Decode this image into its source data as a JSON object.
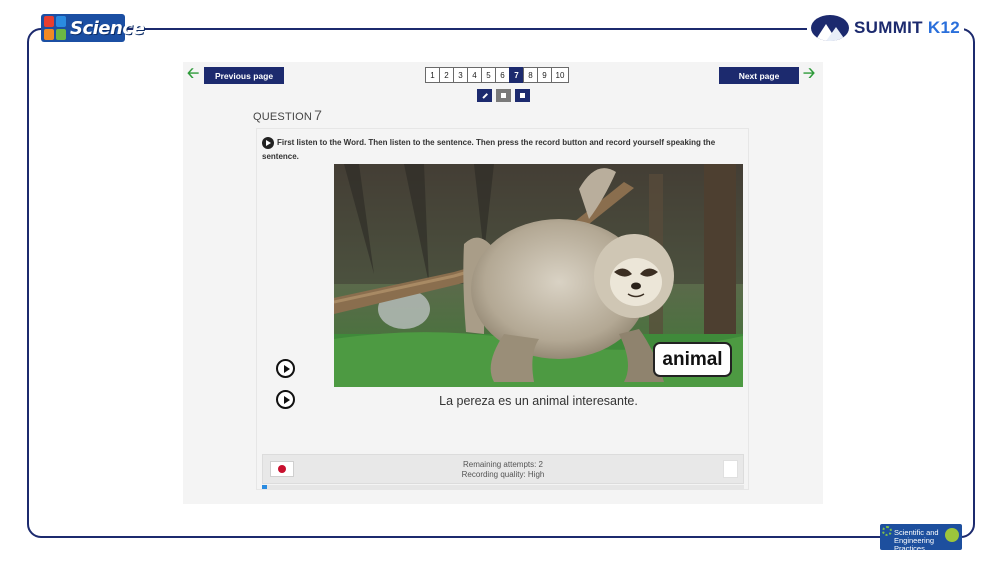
{
  "branding": {
    "science_logo_text": "Science",
    "summit_logo_text": "SUMMIT",
    "summit_logo_suffix": "K12",
    "badge_text": "Scientific and Engineering Practices"
  },
  "nav": {
    "previous_label": "Previous page",
    "next_label": "Next page",
    "pages": [
      "1",
      "2",
      "3",
      "4",
      "5",
      "6",
      "7",
      "8",
      "9",
      "10"
    ],
    "current_page": "7"
  },
  "tools": {
    "icons": [
      "pencil-icon",
      "stop-icon",
      "stop-icon"
    ]
  },
  "question": {
    "label": "QUESTION",
    "number": "7",
    "instruction": "First listen to the Word. Then listen to the sentence. Then press the record button and record yourself speaking the sentence.",
    "word": "animal",
    "sentence": "La pereza es un animal interesante."
  },
  "recorder": {
    "remaining_attempts": "Remaining attempts: 2",
    "recording_quality": "Recording quality: High",
    "progress_percent": 1
  },
  "colors": {
    "navy": "#1c2a6e",
    "arrow_green": "#2e9b3a",
    "record_red": "#c8102e",
    "progress_blue": "#2a8be0"
  }
}
